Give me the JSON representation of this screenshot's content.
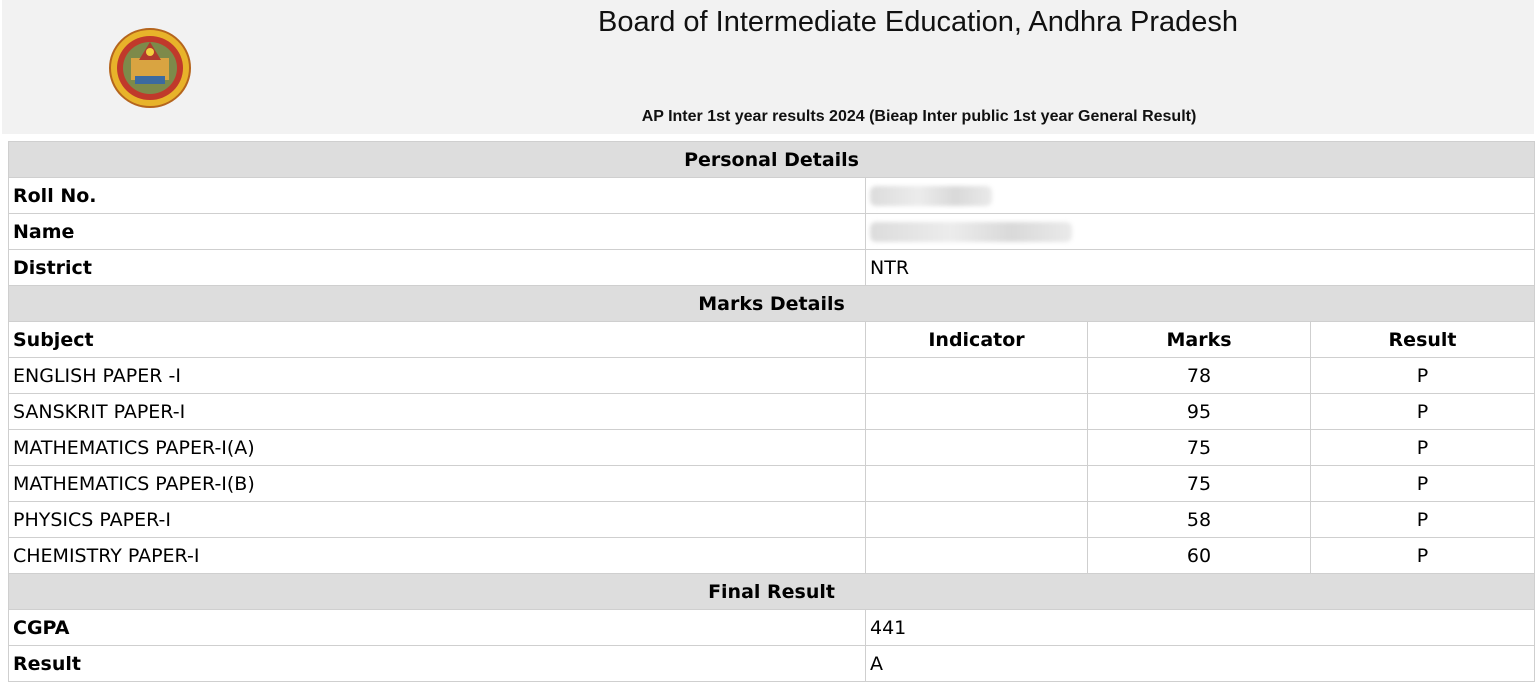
{
  "header": {
    "board_name": "Board of Intermediate Education, Andhra Pradesh",
    "subtitle": "AP Inter 1st year results 2024 (Bieap Inter public 1st year General Result)"
  },
  "personal": {
    "section_title": "Personal Details",
    "roll_label": "Roll No.",
    "name_label": "Name",
    "district_label": "District",
    "district_value": "NTR"
  },
  "marks": {
    "section_title": "Marks Details",
    "headers": {
      "subject": "Subject",
      "indicator": "Indicator",
      "marks": "Marks",
      "result": "Result"
    },
    "rows": [
      {
        "subject": "ENGLISH PAPER -I",
        "indicator": "",
        "marks": "78",
        "result": "P"
      },
      {
        "subject": "SANSKRIT PAPER-I",
        "indicator": "",
        "marks": "95",
        "result": "P"
      },
      {
        "subject": "MATHEMATICS PAPER-I(A)",
        "indicator": "",
        "marks": "75",
        "result": "P"
      },
      {
        "subject": "MATHEMATICS PAPER-I(B)",
        "indicator": "",
        "marks": "75",
        "result": "P"
      },
      {
        "subject": "PHYSICS PAPER-I",
        "indicator": "",
        "marks": "58",
        "result": "P"
      },
      {
        "subject": "CHEMISTRY PAPER-I",
        "indicator": "",
        "marks": "60",
        "result": "P"
      }
    ]
  },
  "final": {
    "section_title": "Final Result",
    "cgpa_label": "CGPA",
    "cgpa_value": "441",
    "result_label": "Result",
    "result_value": "A"
  }
}
